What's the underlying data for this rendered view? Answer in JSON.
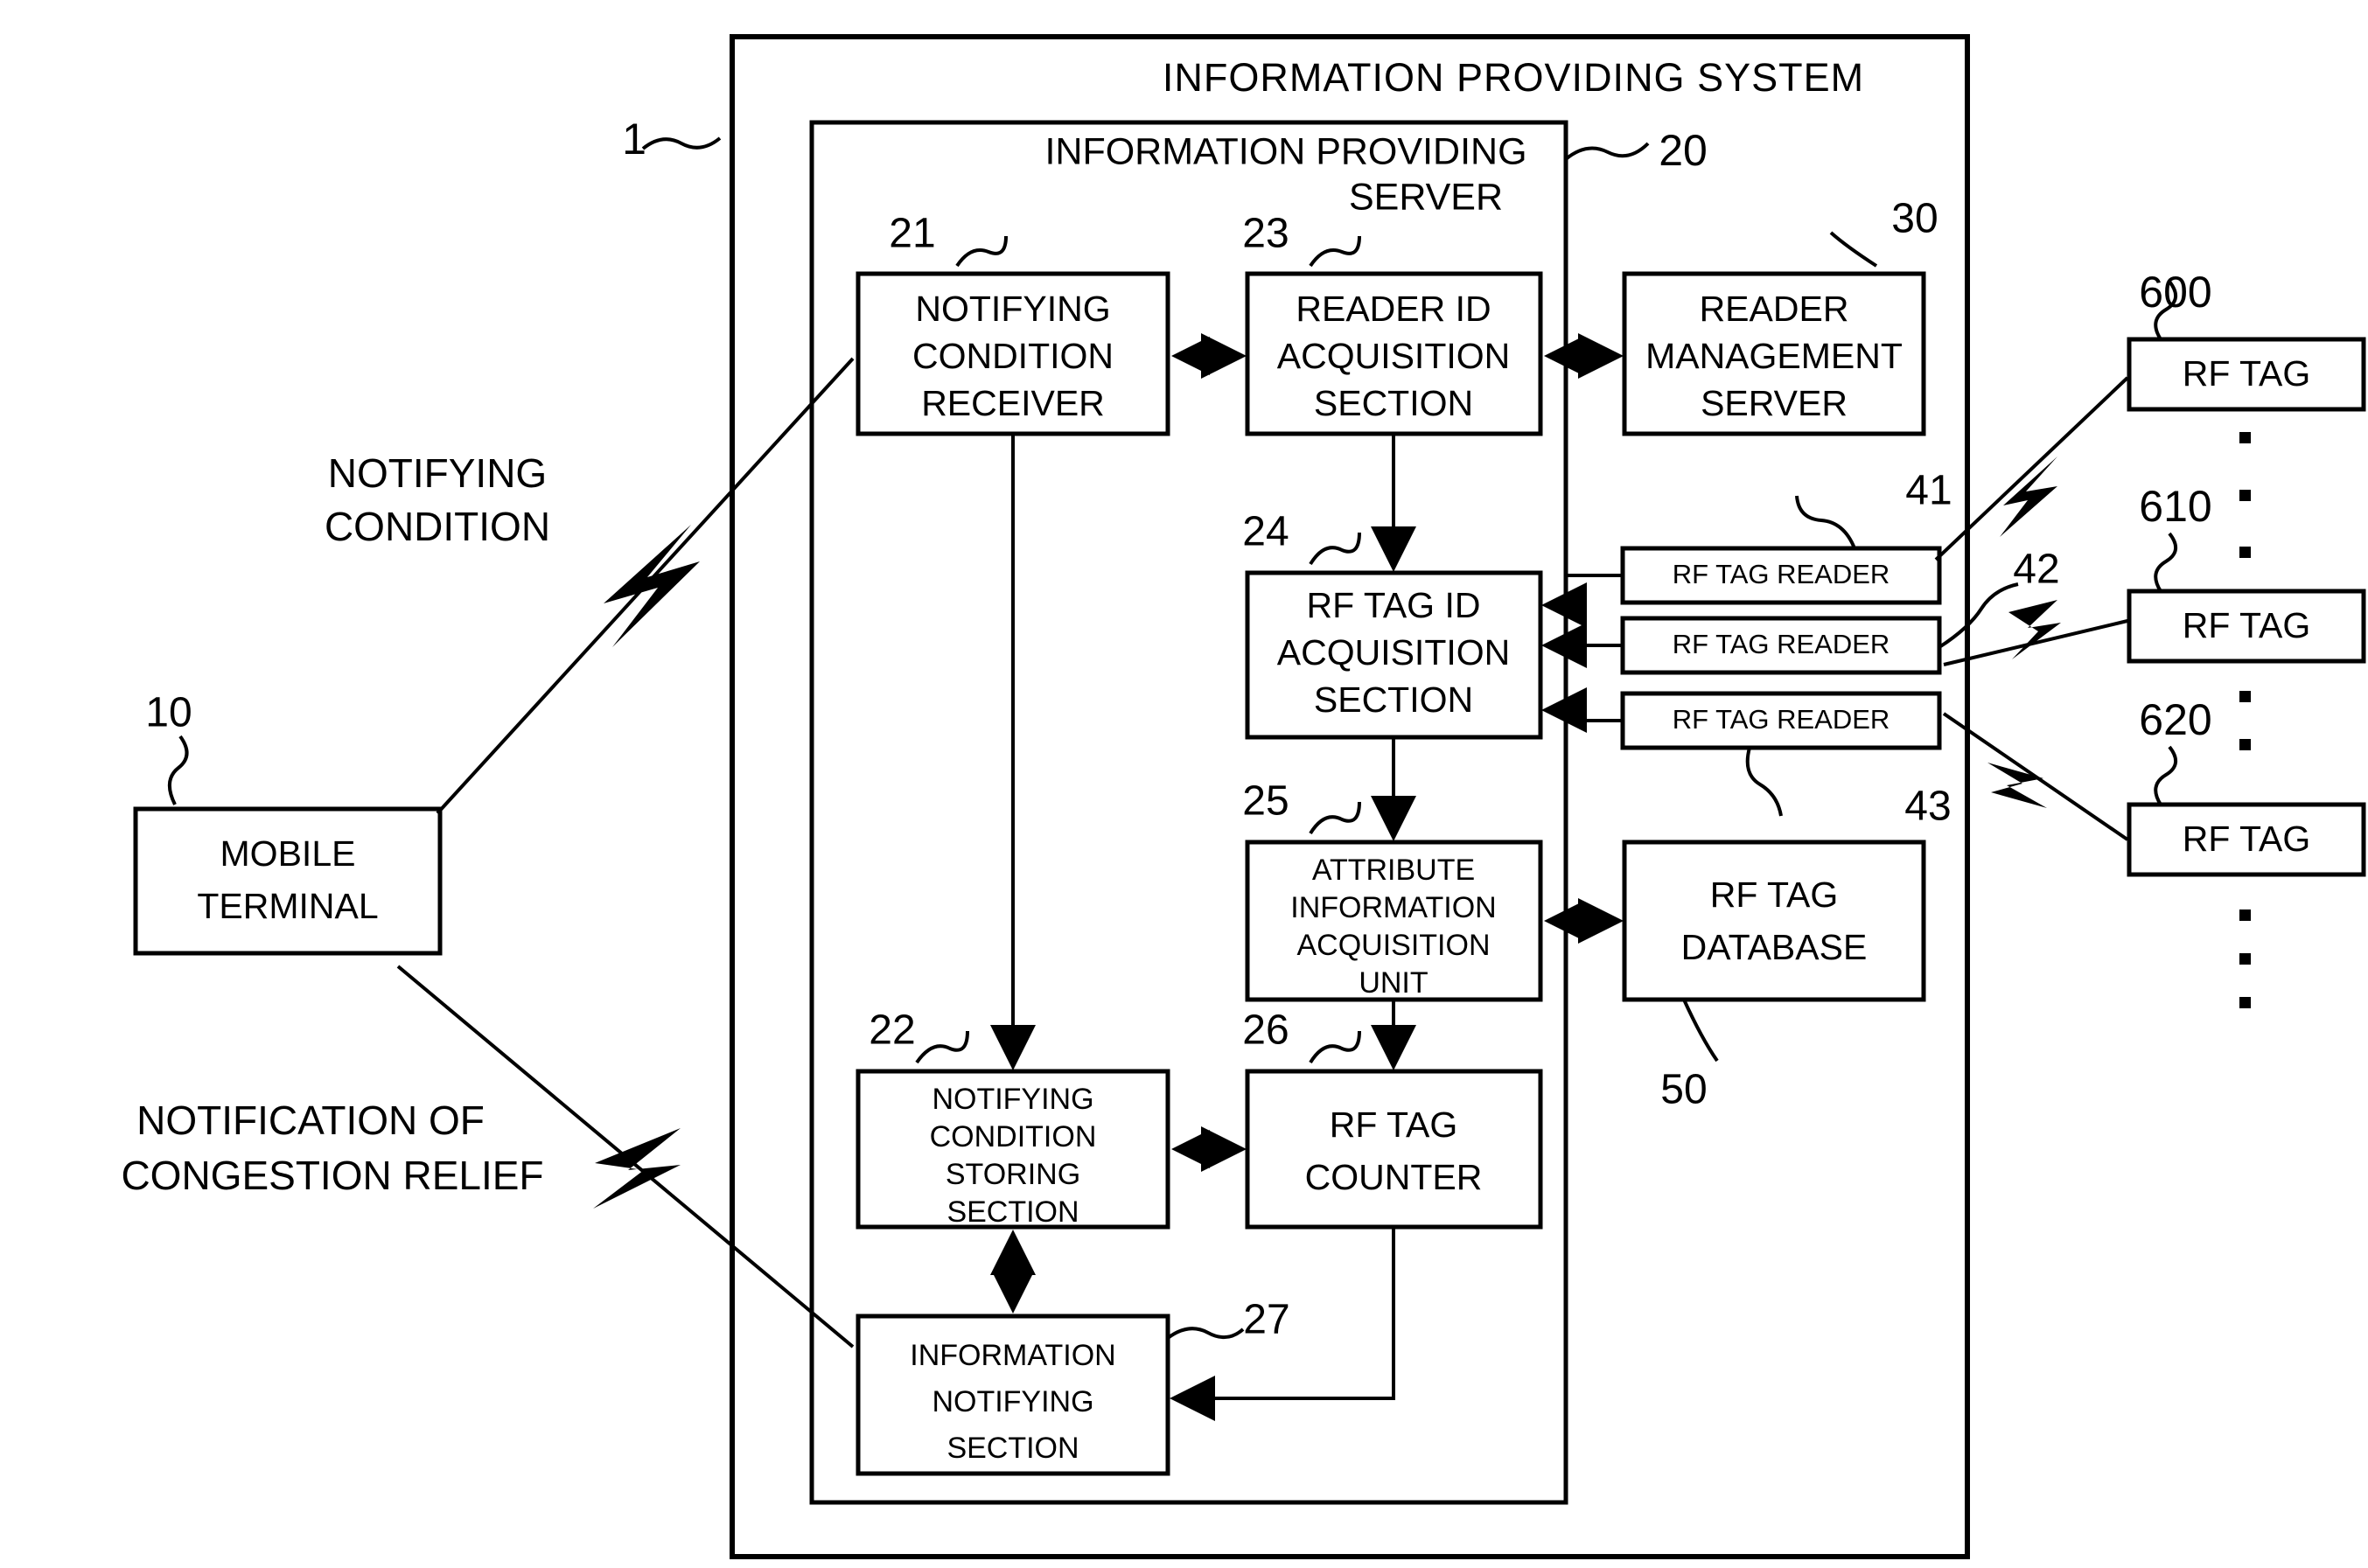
{
  "figure": {
    "kind": "patent-block-diagram",
    "system_label": "INFORMATION PROVIDING SYSTEM",
    "system_ref": "1",
    "server_label_line1": "INFORMATION PROVIDING",
    "server_label_line2": "SERVER",
    "server_ref": "20"
  },
  "left_annotations": {
    "notifying_condition_line1": "NOTIFYING",
    "notifying_condition_line2": "CONDITION",
    "congestion_line1": "NOTIFICATION OF",
    "congestion_line2": "CONGESTION RELIEF"
  },
  "blocks": {
    "mobile_terminal": {
      "ref": "10",
      "line1": "MOBILE",
      "line2": "TERMINAL"
    },
    "notifying_condition_receiver": {
      "ref": "21",
      "line1": "NOTIFYING",
      "line2": "CONDITION",
      "line3": "RECEIVER"
    },
    "notifying_condition_storing": {
      "ref": "22",
      "line1": "NOTIFYING",
      "line2": "CONDITION",
      "line3": "STORING",
      "line4": "SECTION"
    },
    "reader_id_acquisition": {
      "ref": "23",
      "line1": "READER ID",
      "line2": "ACQUISITION",
      "line3": "SECTION"
    },
    "rf_tag_id_acquisition": {
      "ref": "24",
      "line1": "RF TAG ID",
      "line2": "ACQUISITION",
      "line3": "SECTION"
    },
    "attribute_information_acquisition": {
      "ref": "25",
      "line1": "ATTRIBUTE",
      "line2": "INFORMATION",
      "line3": "ACQUISITION",
      "line4": "UNIT"
    },
    "rf_tag_counter": {
      "ref": "26",
      "line1": "RF TAG",
      "line2": "COUNTER"
    },
    "information_notifying": {
      "ref": "27",
      "line1": "INFORMATION",
      "line2": "NOTIFYING",
      "line3": "SECTION"
    },
    "reader_management_server": {
      "ref": "30",
      "line1": "READER",
      "line2": "MANAGEMENT",
      "line3": "SERVER"
    },
    "rf_tag_database": {
      "ref": "50",
      "line1": "RF TAG",
      "line2": "DATABASE"
    }
  },
  "readers": [
    {
      "ref": "41",
      "label": "RF TAG READER"
    },
    {
      "ref": "42",
      "label": "RF TAG READER"
    },
    {
      "ref": "43",
      "label": "RF TAG READER"
    }
  ],
  "tags": [
    {
      "ref": "600",
      "label": "RF TAG"
    },
    {
      "ref": "610",
      "label": "RF TAG"
    },
    {
      "ref": "620",
      "label": "RF TAG"
    }
  ],
  "colors": {
    "ink": "#000000",
    "paper": "#ffffff"
  }
}
